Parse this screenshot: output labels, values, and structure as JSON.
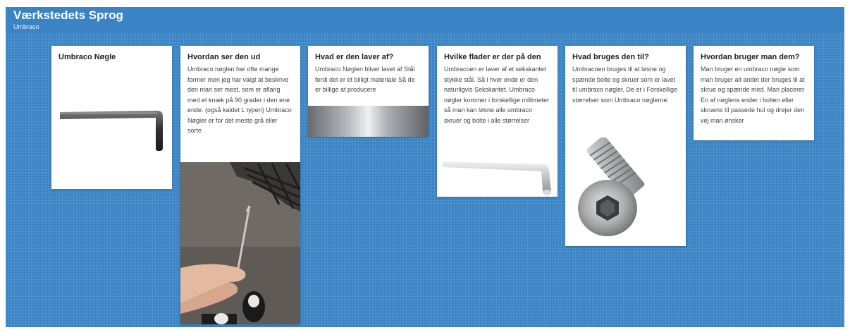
{
  "board": {
    "title": "Værkstedets Sprog",
    "subtitle": "Umbraco"
  },
  "cards": [
    {
      "title": "Umbraco Nøgle",
      "body": "",
      "image": "hex-key-icon"
    },
    {
      "title": "Hvordan ser den ud",
      "body": "Umbraco nøglen har ofte mange former men jeg har valgt at beskrive den man ser mest, som er aflang med et knæk på 90 grader i den ene ende. (også kaldet L typen) Umbraco Nøgler er for det meste grå eller sorte",
      "image": "hand-holding-key-photo"
    },
    {
      "title": "Hvad er den laver af?",
      "body": "Umbraco Nøglen bliver lavet af Stål fordi det er et billigt materiale Så de er billige at producere",
      "image": "brushed-steel-photo"
    },
    {
      "title": "Hvilke flader er der på den",
      "body": "Umbracoen er laver af et sekskantet stykke stål. Så i hver ende er den naturligvis Sekskantet. Umbraco nøgler kommer i forskellige millimeter så man kan løsne alle umbraco skruer og bolte i alle størrelser",
      "image": "silver-hex-key-icon"
    },
    {
      "title": "Hvad bruges den til?",
      "body": "Umbracoen bruges til at løsne og spænde bolte og skruer som er lavet til umbraco nøgler. De er i Forskellige størrelser som Umbraco nøglerne.",
      "image": "socket-bolt-photo"
    },
    {
      "title": "Hvordan bruger man dem?",
      "body": "Man bruger en umbraco nøgle som man bruger alt andet der bruges til at skrue og spænde med. Man placerer En af nøglens ender i bolten eller skruens til passede hul og drejer den vej man ønsker",
      "image": ""
    }
  ],
  "colors": {
    "background": "#3a84c6",
    "card": "#ffffff",
    "title_text": "#222222",
    "body_text": "#444444"
  }
}
